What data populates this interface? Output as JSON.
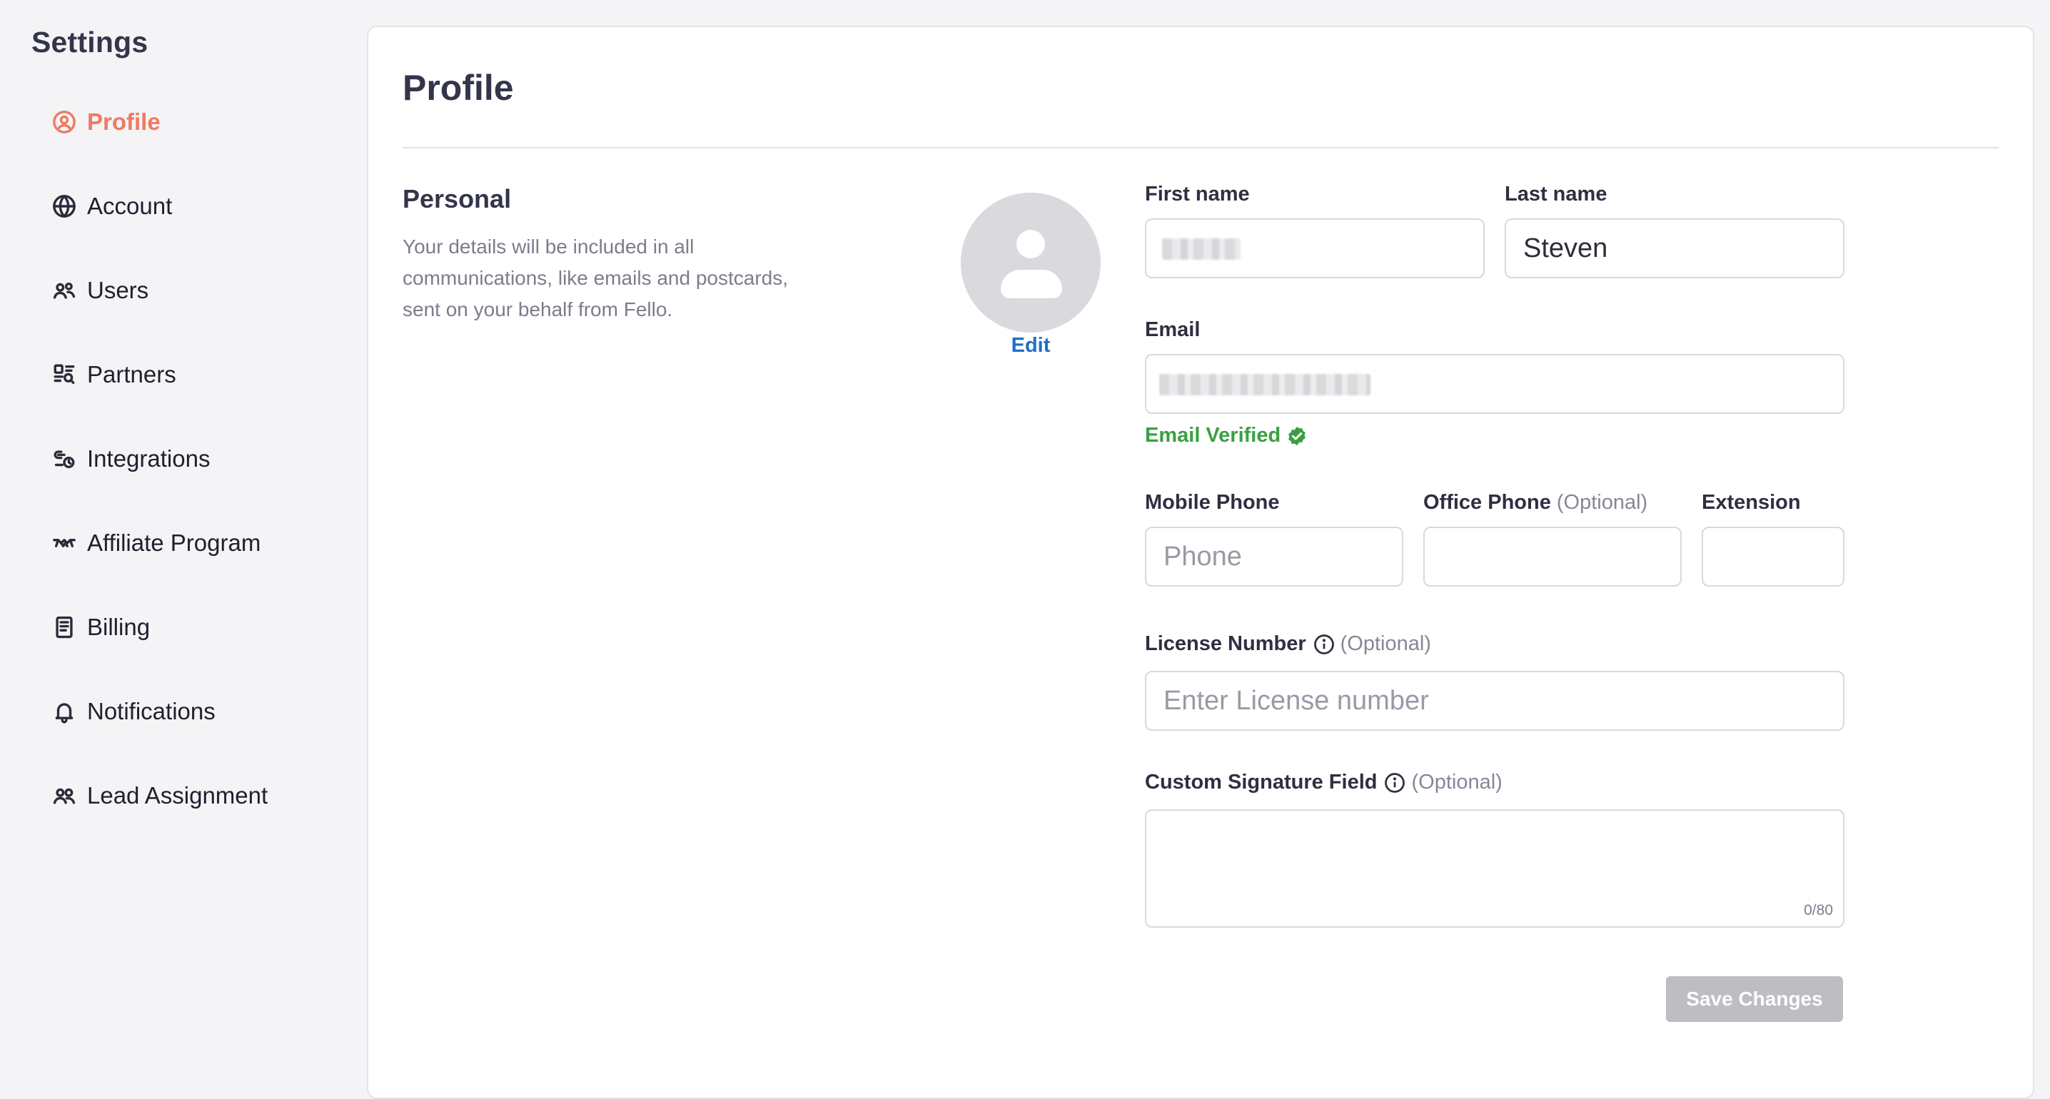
{
  "sidebar": {
    "title": "Settings",
    "items": [
      {
        "label": "Profile",
        "icon": "user-circle-icon"
      },
      {
        "label": "Account",
        "icon": "globe-icon"
      },
      {
        "label": "Users",
        "icon": "users-icon"
      },
      {
        "label": "Partners",
        "icon": "partners-icon"
      },
      {
        "label": "Integrations",
        "icon": "integrations-icon"
      },
      {
        "label": "Affiliate Program",
        "icon": "handshake-icon"
      },
      {
        "label": "Billing",
        "icon": "receipt-icon"
      },
      {
        "label": "Notifications",
        "icon": "bell-icon"
      },
      {
        "label": "Lead Assignment",
        "icon": "user-group-icon"
      }
    ],
    "active_color": "#ef7a61"
  },
  "page": {
    "title": "Profile"
  },
  "personal": {
    "title": "Personal",
    "description": "Your details will be included in all communications, like emails and postcards, sent on your behalf from Fello.",
    "avatar_edit": "Edit"
  },
  "form": {
    "first_name": {
      "label": "First name",
      "value": ""
    },
    "last_name": {
      "label": "Last name",
      "value": "Steven"
    },
    "email": {
      "label": "Email",
      "value": "",
      "status": "Email Verified"
    },
    "mobile_phone": {
      "label": "Mobile Phone",
      "placeholder": "Phone",
      "value": ""
    },
    "office_phone": {
      "label": "Office Phone",
      "optional": "(Optional)",
      "value": ""
    },
    "extension": {
      "label": "Extension",
      "value": ""
    },
    "license": {
      "label": "License Number",
      "optional": "(Optional)",
      "placeholder": "Enter License number"
    },
    "signature": {
      "label": "Custom Signature Field",
      "optional": "(Optional)",
      "counter": "0/80"
    },
    "save_label": "Save Changes"
  },
  "colors": {
    "accent": "#ef7a61",
    "verified": "#3aa043",
    "link": "#1f6fc9",
    "button_disabled": "#bdbdc2"
  }
}
